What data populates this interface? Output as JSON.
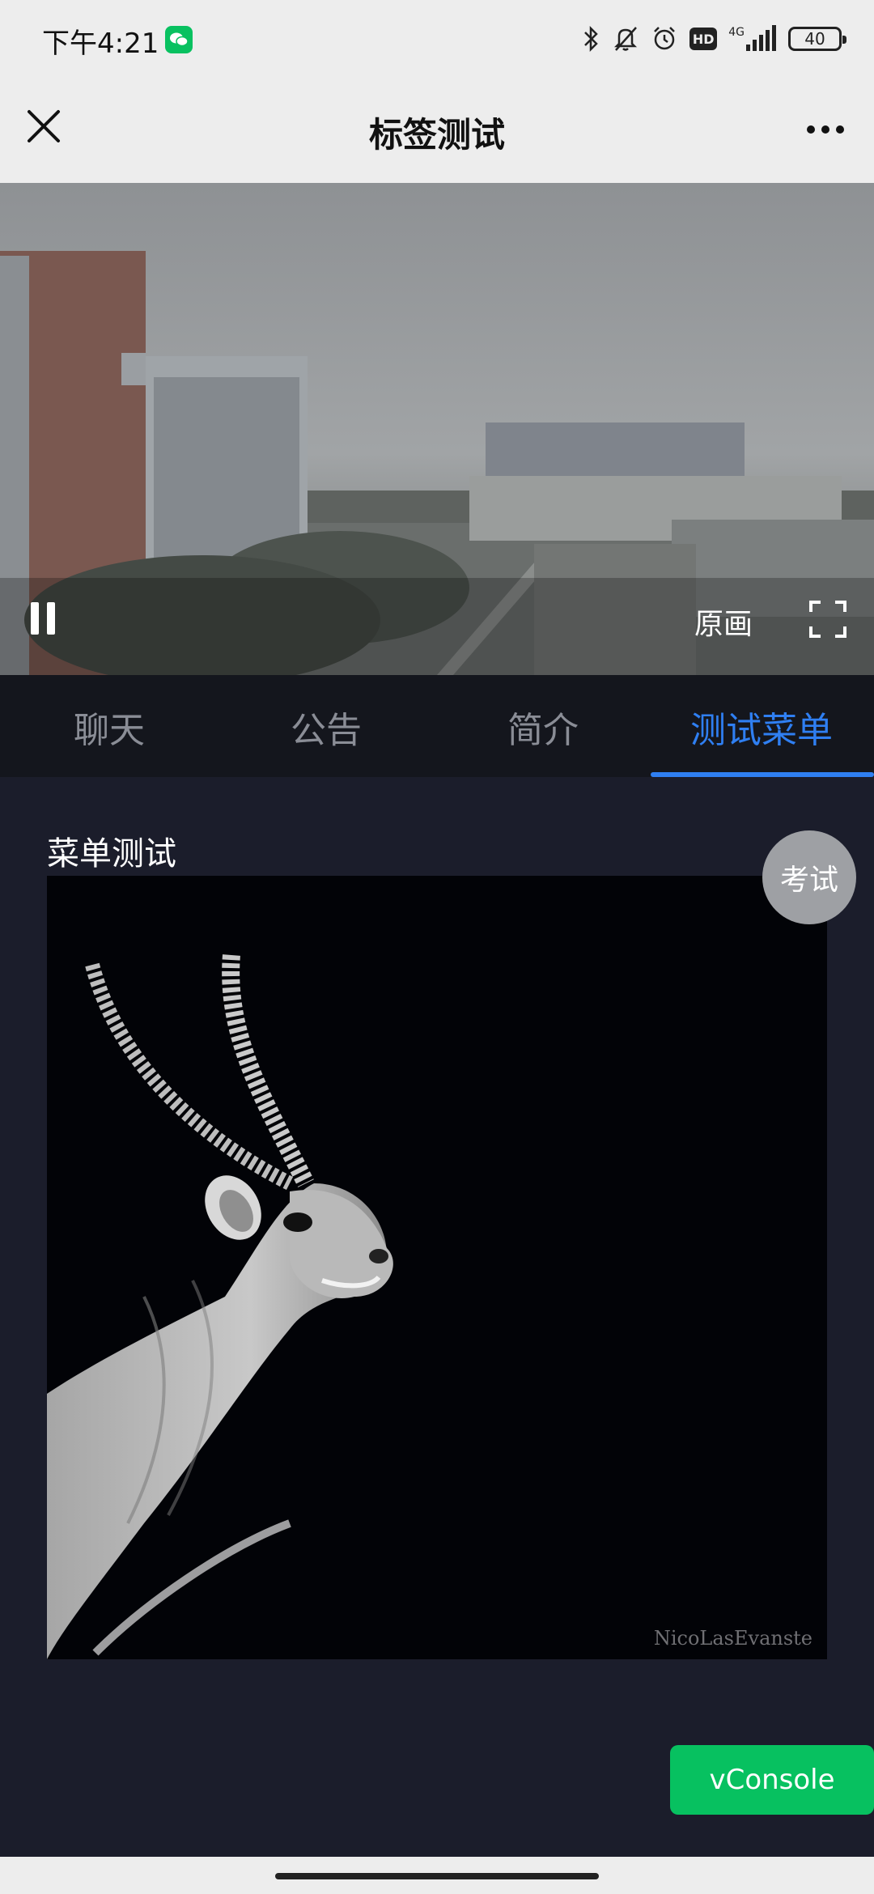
{
  "status_bar": {
    "time": "下午4:21",
    "network_label": "4G",
    "battery_level": "40"
  },
  "header": {
    "title": "标签测试"
  },
  "video": {
    "quality_label": "原画"
  },
  "tabs": [
    {
      "label": "聊天",
      "active": false
    },
    {
      "label": "公告",
      "active": false
    },
    {
      "label": "简介",
      "active": false
    },
    {
      "label": "测试菜单",
      "active": true
    }
  ],
  "content": {
    "section_title": "菜单测试",
    "image_watermark": "NicoLasEvanste",
    "exam_button": "考试",
    "vconsole_button": "vConsole"
  },
  "colors": {
    "accent": "#2f7ff2",
    "wechat_green": "#07c160",
    "content_bg": "#1b1d2b",
    "tab_bg": "#14161d"
  }
}
